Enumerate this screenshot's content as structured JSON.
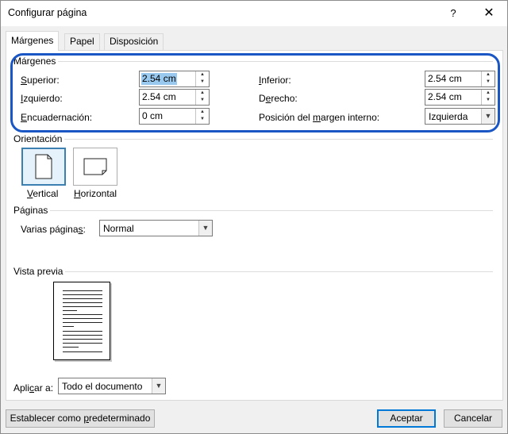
{
  "window": {
    "title": "Configurar página",
    "help": "?",
    "close": "✕"
  },
  "tabs": [
    "Márgenes",
    "Papel",
    "Disposición"
  ],
  "margins": {
    "section": "Márgenes",
    "top": {
      "label_u": "S",
      "label_rest": "uperior:",
      "value": "2.54 cm"
    },
    "left": {
      "label_u": "I",
      "label_rest": "zquierdo:",
      "value": "2.54 cm"
    },
    "gutter": {
      "label_u": "E",
      "label_rest": "ncuadernación:",
      "value": "0 cm"
    },
    "bottom": {
      "label_u": "I",
      "label_rest": "nferior:",
      "value": "2.54 cm"
    },
    "right": {
      "label_pre": "D",
      "label_u": "e",
      "label_rest": "recho:",
      "value": "2.54 cm"
    },
    "gutter_pos": {
      "label_pre": "Posición del ",
      "label_u": "m",
      "label_rest": "argen interno:",
      "value": "Izquierda"
    }
  },
  "orientation": {
    "section": "Orientación",
    "portrait": {
      "label_u": "V",
      "label_rest": "ertical"
    },
    "landscape": {
      "label_u": "H",
      "label_rest": "orizontal"
    }
  },
  "pages": {
    "section": "Páginas",
    "multiple_label_pre": "Varias página",
    "multiple_label_u": "s",
    "multiple_label_rest": ":",
    "multiple_value": "Normal"
  },
  "preview": {
    "section": "Vista previa"
  },
  "apply": {
    "label_pre": "Apli",
    "label_u": "c",
    "label_rest": "ar a:",
    "value": "Todo el documento"
  },
  "buttons": {
    "set_default_pre": "Establecer como ",
    "set_default_u": "p",
    "set_default_rest": "redeterminado",
    "ok": "Aceptar",
    "cancel": "Cancelar"
  },
  "accent_colors": {
    "highlight": "#1a56c4",
    "default_button": "#0078d7",
    "selection": "#99c9ef"
  }
}
